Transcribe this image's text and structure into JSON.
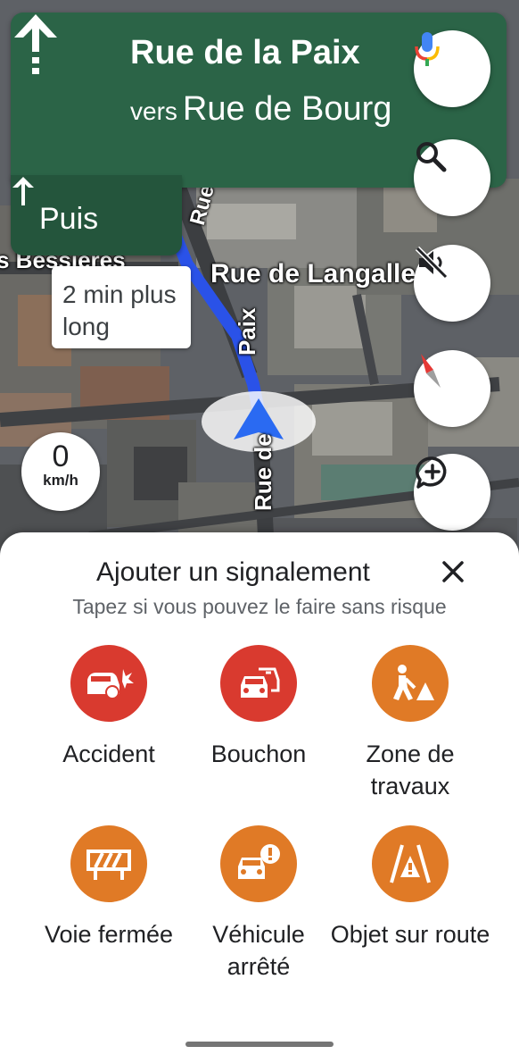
{
  "navigation": {
    "street": "Rue de la Paix",
    "towards_prefix": "vers",
    "towards_street": "Rue de Bourg",
    "then_label": "Puis"
  },
  "map": {
    "labels": {
      "rue_langallerie": "Rue de Langalle",
      "rue_bessieres": "s Bessières",
      "paix_vertical": "Paix",
      "rue_de_vertical": "Rue de",
      "rue_top": "Rue"
    },
    "alt_route": "2 min plus long",
    "speed": {
      "value": "0",
      "unit": "km/h"
    }
  },
  "controls": {
    "icons": [
      "microphone-icon",
      "search-icon",
      "sound-off-icon",
      "compass-icon",
      "add-report-icon"
    ]
  },
  "sheet": {
    "title": "Ajouter un signalement",
    "subtitle": "Tapez si vous pouvez le faire sans risque",
    "reports": [
      {
        "label": "Accident",
        "icon": "car-crash-icon",
        "color": "#d93a2f"
      },
      {
        "label": "Bouchon",
        "icon": "traffic-jam-icon",
        "color": "#d93a2f"
      },
      {
        "label": "Zone de travaux",
        "icon": "roadwork-icon",
        "color": "#e07a26"
      },
      {
        "label": "Voie fermée",
        "icon": "lane-closed-icon",
        "color": "#e07a26"
      },
      {
        "label": "Véhicule arrêté",
        "icon": "stalled-vehicle-icon",
        "color": "#e07a26"
      },
      {
        "label": "Objet sur route",
        "icon": "road-object-icon",
        "color": "#e07a26"
      }
    ]
  },
  "colors": {
    "nav_green": "#2b6447",
    "then_green": "#24553c",
    "route_blue": "#2a52e8",
    "red": "#d93a2f",
    "orange": "#e07a26"
  }
}
